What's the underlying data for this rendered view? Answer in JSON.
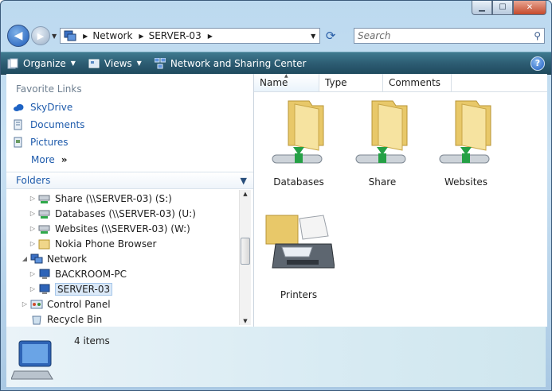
{
  "window": {
    "controls": {
      "minimize": "▁",
      "maximize": "☐",
      "close": "✕"
    }
  },
  "address": {
    "segments": [
      "Network",
      "SERVER-03"
    ],
    "search_placeholder": "Search"
  },
  "toolbar": {
    "organize": "Organize",
    "views": "Views",
    "network_center": "Network and Sharing Center",
    "help": "?"
  },
  "favorites": {
    "title": "Favorite Links",
    "links": [
      "SkyDrive",
      "Documents",
      "Pictures"
    ],
    "more": "More",
    "more_glyph": "»"
  },
  "folders": {
    "title": "Folders",
    "tree": [
      "Share (\\\\SERVER-03) (S:)",
      "Databases (\\\\SERVER-03) (U:)",
      "Websites (\\\\SERVER-03) (W:)",
      "Nokia Phone Browser",
      "Network",
      "BACKROOM-PC",
      "SERVER-03",
      "Control Panel",
      "Recycle Bin"
    ]
  },
  "columns": [
    "Name",
    "Type",
    "Comments"
  ],
  "items": [
    "Databases",
    "Share",
    "Websites",
    "Printers"
  ],
  "status": {
    "count": "4 items"
  },
  "colors": {
    "link": "#1d5aab",
    "toolbar": "#2d5d73"
  }
}
